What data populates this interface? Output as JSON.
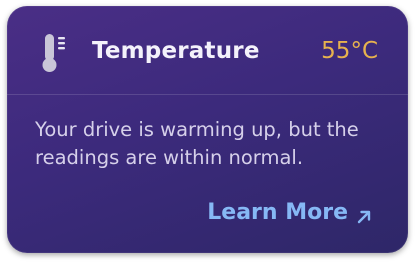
{
  "card": {
    "title": "Temperature",
    "temperature": "55°C",
    "icon": "thermometer-icon",
    "message": "Your drive is warming up, but the readings are within normal.",
    "link_label": "Learn More",
    "link_icon": "arrow-up-right-icon",
    "colors": {
      "background": "#3c2a7c",
      "temperature": "#e7b24e",
      "link": "#86b8f5"
    }
  }
}
